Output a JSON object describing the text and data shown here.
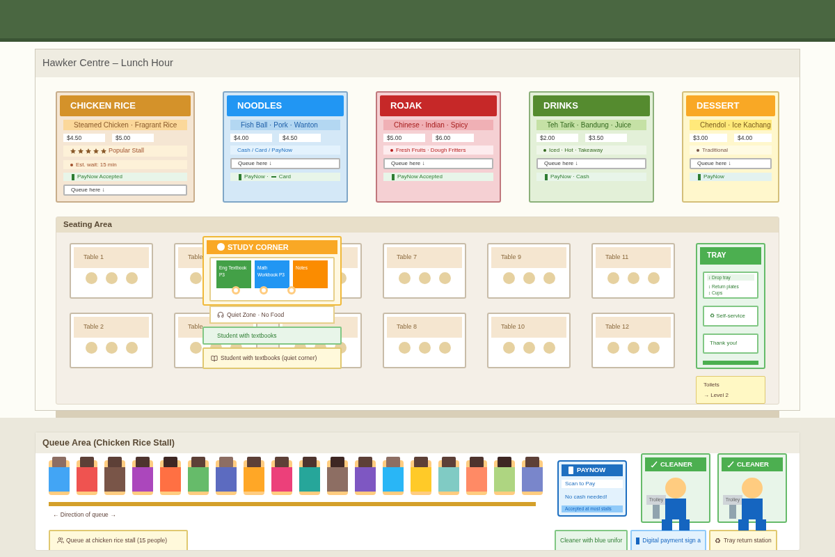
{
  "header": {
    "title": "Hawker Centre – Lunch Hour"
  },
  "stalls": [
    {
      "name": "CHICKEN RICE",
      "color": "#d4922a",
      "subtitle": "Steamed Chicken · Fragrant Rice",
      "prices": [
        "$4.50",
        "$5.00"
      ],
      "rows": [
        {
          "kind": "rating",
          "stars": 5,
          "text": "Popular Stall"
        },
        {
          "kind": "note",
          "icon": true,
          "text": "Est. wait: 15 min"
        },
        {
          "kind": "pay",
          "parts": [
            "PayNow Accepted"
          ]
        },
        {
          "kind": "queue",
          "text": "Queue here ↓"
        }
      ]
    },
    {
      "name": "NOODLES",
      "color": "#2196f3",
      "subtitle": "Fish Ball · Pork · Wanton",
      "prices": [
        "$4.00",
        "$4.50"
      ],
      "rows": [
        {
          "kind": "note",
          "text": "Cash / Card / PayNow"
        },
        {
          "kind": "queue",
          "text": "Queue here ↓"
        },
        {
          "kind": "pay",
          "parts": [
            "PayNow ·",
            "Card"
          ]
        }
      ]
    },
    {
      "name": "ROJAK",
      "color": "#c62828",
      "subtitle": "Chinese · Indian · Spicy",
      "prices": [
        "$5.00",
        "$6.00"
      ],
      "rows": [
        {
          "kind": "note",
          "icon": true,
          "text": "Fresh Fruits · Dough Fritters"
        },
        {
          "kind": "queue",
          "text": "Queue here ↓"
        },
        {
          "kind": "pay",
          "parts": [
            "PayNow Accepted"
          ]
        }
      ]
    },
    {
      "name": "DRINKS",
      "color": "#558b2f",
      "subtitle": "Teh Tarik · Bandung · Juice",
      "prices": [
        "$2.00",
        "$3.50"
      ],
      "rows": [
        {
          "kind": "note",
          "icon": true,
          "text": "Iced · Hot · Takeaway"
        },
        {
          "kind": "queue",
          "text": "Queue here ↓"
        },
        {
          "kind": "pay",
          "parts": [
            "PayNow · Cash"
          ]
        }
      ]
    },
    {
      "name": "DESSERT",
      "color": "#f9a825",
      "subtitle": "Chendol · Ice Kachang",
      "prices": [
        "$3.00",
        "$4.00"
      ],
      "rows": [
        {
          "kind": "note",
          "icon": true,
          "text": "Traditional"
        },
        {
          "kind": "queue",
          "text": "Queue here ↓"
        },
        {
          "kind": "pay",
          "parts": [
            "PayNow"
          ]
        }
      ]
    }
  ],
  "seating": {
    "title": "Seating Area",
    "columns": [
      [
        {
          "label": "Table 1"
        },
        {
          "label": "Table 2"
        }
      ],
      [
        {
          "label": "Table"
        },
        {
          "label": "Table"
        }
      ],
      [
        {},
        {}
      ],
      [
        {
          "label": "Table 7"
        },
        {
          "label": "Table 8"
        }
      ],
      [
        {
          "label": "Table 9"
        },
        {
          "label": "Table 10"
        }
      ],
      [
        {
          "label": "Table 11"
        },
        {
          "label": "Table 12"
        }
      ]
    ],
    "study_corner": {
      "title": "STUDY CORNER",
      "books": [
        {
          "text": "Eng Textbook P3",
          "color": "#43a047"
        },
        {
          "text": "Math Workbook P3",
          "color": "#2196f3"
        },
        {
          "text": "Notes",
          "color": "#fb8c00"
        }
      ],
      "note": "Quiet Zone · No Food"
    },
    "captions": [
      {
        "kind": "green",
        "text": "Student with textbooks"
      },
      {
        "kind": "yellow",
        "text": "Student with textbooks (quiet corner)"
      }
    ],
    "tray": {
      "title": "TRAY",
      "steps": [
        "↕ Drop tray",
        "↕ Return plates",
        "↕ Cups"
      ],
      "cards": [
        "♻ Self-service",
        "Thank you!"
      ]
    },
    "toilets": {
      "title": "Toilets",
      "sub": "→ Level 2"
    }
  },
  "queue": {
    "title": "Queue Area (Chicken Rice Stall)",
    "people": [
      {
        "color": "#42a5f5"
      },
      {
        "color": "#ef5350"
      },
      {
        "color": "#795548"
      },
      {
        "color": "#ab47bc"
      },
      {
        "color": "#ff7043"
      },
      {
        "color": "#66bb6a"
      },
      {
        "color": "#5c6bc0"
      },
      {
        "color": "#ffa726"
      },
      {
        "color": "#ec407a"
      },
      {
        "color": "#26a69a"
      },
      {
        "color": "#8d6e63"
      },
      {
        "color": "#7e57c2"
      },
      {
        "color": "#29b6f6"
      },
      {
        "color": "#ffca28"
      },
      {
        "color": "#80cbc4"
      },
      {
        "color": "#ff8a65"
      },
      {
        "color": "#aed581"
      },
      {
        "color": "#7986cb"
      }
    ],
    "direction": "← Direction of queue →",
    "caption": "Queue at chicken rice stall (15 people)",
    "paynow": {
      "title": "PAYNOW",
      "lines": [
        "Scan to Pay",
        "No cash needed!"
      ],
      "tag": "Accepted at most stalls"
    },
    "cleaners": [
      {
        "title": "CLEANER",
        "trolley": "Trolley"
      },
      {
        "title": "CLEANER",
        "trolley": "Trolley"
      }
    ],
    "captions": [
      {
        "kind": "green",
        "text": "Cleaner with blue unifor"
      },
      {
        "kind": "blue",
        "text": "Digital payment sign a"
      },
      {
        "kind": "yellow",
        "icon": "♻",
        "text": "Tray return station"
      }
    ]
  }
}
